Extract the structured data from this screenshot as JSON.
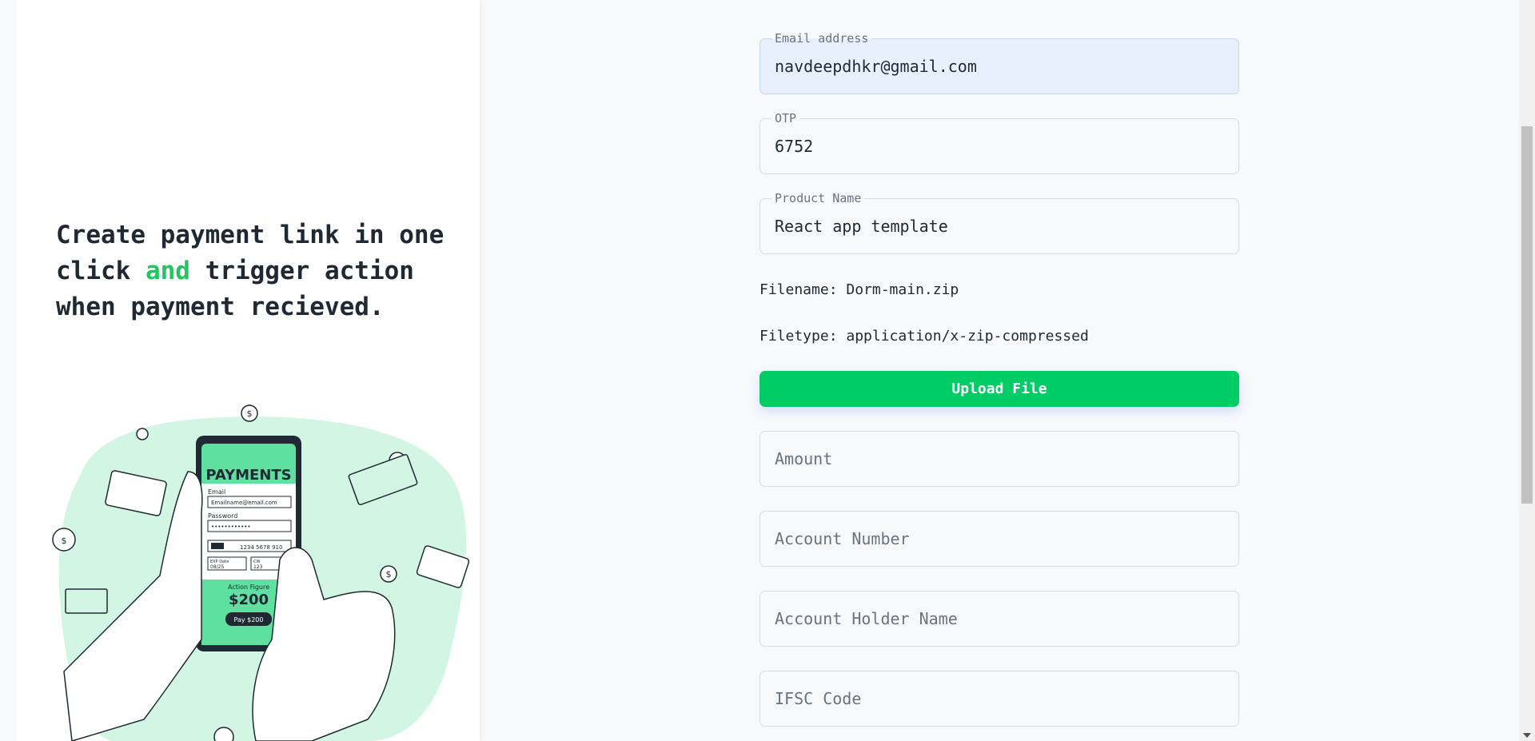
{
  "hero": {
    "line1": "Create payment link in one",
    "line2_pre": "click ",
    "line2_accent": "and",
    "line2_post": " trigger action",
    "line3": "when payment recieved."
  },
  "illustration": {
    "phone_title": "PAYMENTS",
    "email_label": "Email",
    "email_value": "Emailname@email.com",
    "password_label": "Password",
    "password_value": "••••••••••••",
    "card_number": "1234 5678 910",
    "exp_label": "EXP Date",
    "exp_value": "08/25",
    "cvv_label": "CW",
    "cvv_value": "123",
    "product": "Action Figure",
    "price": "$200",
    "pay_button": "Pay $200"
  },
  "form": {
    "email": {
      "label": "Email address",
      "value": "navdeepdhkr@gmail.com"
    },
    "otp": {
      "label": "OTP",
      "value": "6752"
    },
    "product": {
      "label": "Product Name",
      "value": "React app template"
    },
    "filename": "Filename: Dorm-main.zip",
    "filetype": "Filetype: application/x-zip-compressed",
    "upload_label": "Upload File",
    "amount_placeholder": "Amount",
    "account_number_placeholder": "Account Number",
    "account_holder_placeholder": "Account Holder Name",
    "ifsc_placeholder": "IFSC Code"
  },
  "colors": {
    "accent_green": "#22c55e",
    "button_green": "#00cc66",
    "illustration_mint": "#d3f5e4",
    "phone_green": "#5ee0a0"
  }
}
